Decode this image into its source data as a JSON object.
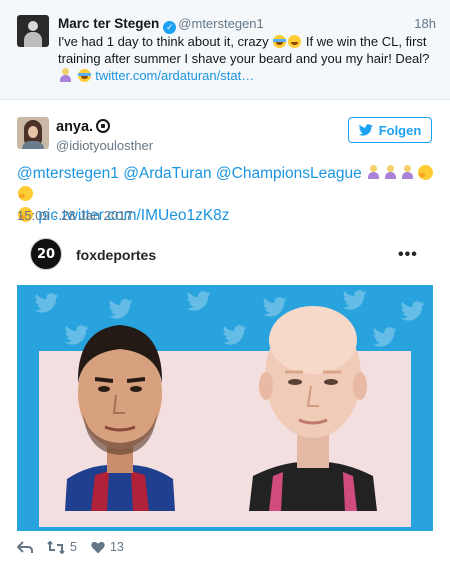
{
  "quoted_tweet": {
    "name": "Marc ter Stegen",
    "handle": "@mterstegen1",
    "time": "18h",
    "text_1": "I've had 1 day to think about it, crazy",
    "text_2": "If we win the CL, first training after summer I shave your beard and you my hair! Deal?",
    "link": "twitter.com/ardaturan/stat…"
  },
  "main_tweet": {
    "name": "anya.",
    "handle": "@idiotyoulosther",
    "follow_label": "Folgen",
    "mentions": "@mterstegen1 @ArdaTuran @ChampionsLeague",
    "link": "pic.twitter.com/IMUeo1zK8z",
    "date": "15:09 - 28 Jan 2017"
  },
  "embedded_post": {
    "avatar_text": "20",
    "account_name": "foxdeportes",
    "more_label": "•••"
  },
  "actions": {
    "retweets": "5",
    "likes": "13"
  },
  "colors": {
    "link_blue": "#1b95e0",
    "follow_blue": "#1da1f2",
    "meta_grey": "#657786",
    "photo_background": "#29a3dd"
  }
}
